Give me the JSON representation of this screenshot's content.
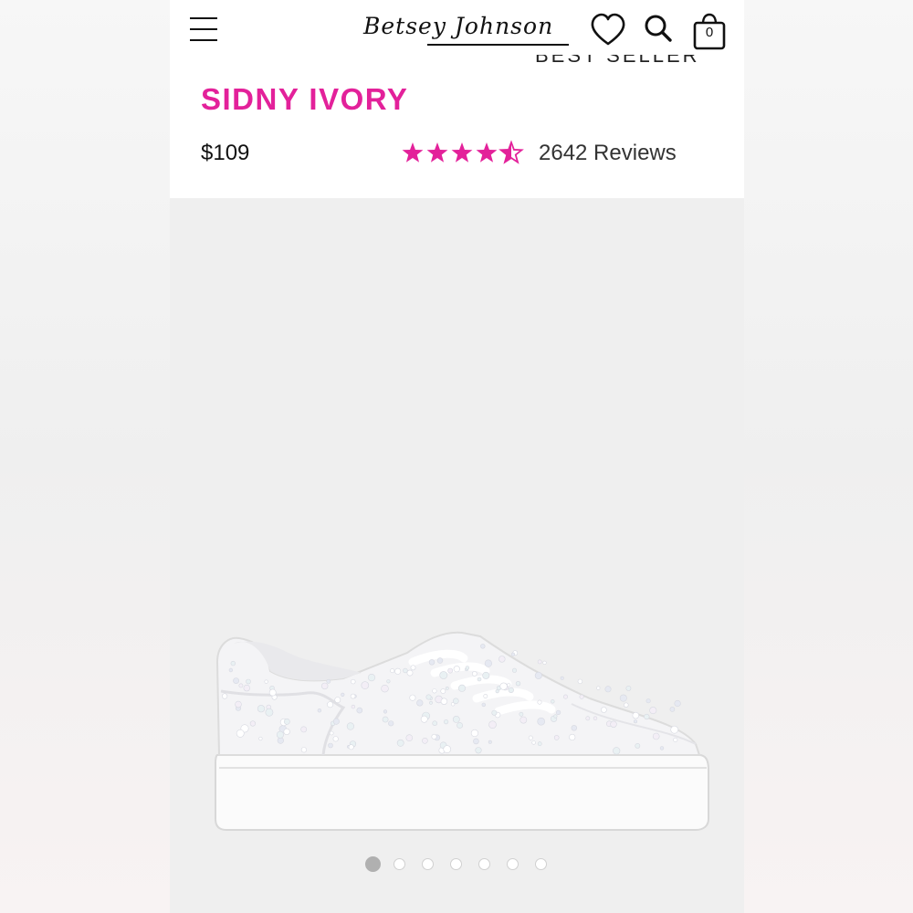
{
  "header": {
    "brand": "Betsey Johnson",
    "cart_count": "0",
    "menu_icon": "hamburger-menu-icon",
    "wishlist_icon": "heart-icon",
    "search_icon": "search-icon",
    "cart_icon": "shopping-bag-icon"
  },
  "product": {
    "badge": "BEST SELLER",
    "name": "SIDNY IVORY",
    "price": "$109",
    "rating": 4.5,
    "rating_max": 5,
    "reviews_label": "2642 Reviews"
  },
  "gallery": {
    "image_count": 7,
    "active_index": 0
  },
  "colors": {
    "accent_pink": "#e3219a",
    "text": "#111111",
    "gallery_bg": "#efefef"
  }
}
